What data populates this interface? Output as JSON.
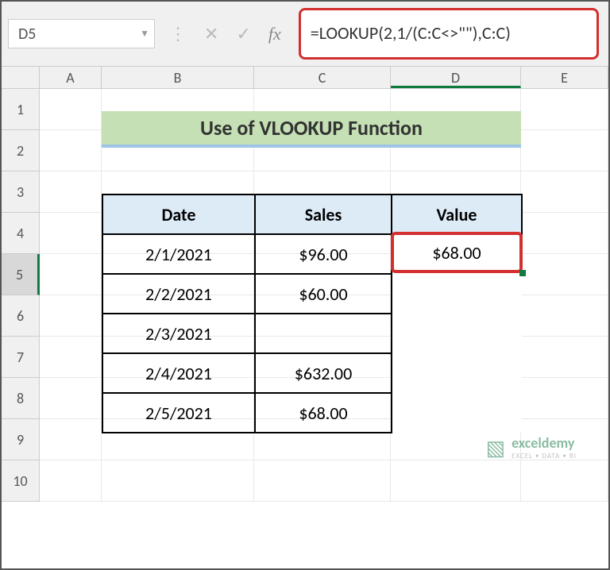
{
  "name_box": "D5",
  "formula": "=LOOKUP(2,1/(C:C<>\"\"),C:C)",
  "columns": [
    "A",
    "B",
    "C",
    "D",
    "E"
  ],
  "row_numbers": [
    "1",
    "2",
    "3",
    "4",
    "5",
    "6",
    "7",
    "8",
    "9",
    "10"
  ],
  "title": "Use of VLOOKUP Function",
  "headers": {
    "date": "Date",
    "sales": "Sales",
    "value": "Value"
  },
  "rows": [
    {
      "date": "2/1/2021",
      "sales": "$96.00"
    },
    {
      "date": "2/2/2021",
      "sales": "$60.00"
    },
    {
      "date": "2/3/2021",
      "sales": ""
    },
    {
      "date": "2/4/2021",
      "sales": "$632.00"
    },
    {
      "date": "2/5/2021",
      "sales": "$68.00"
    }
  ],
  "result_value": "$68.00",
  "selected_cell": "D5",
  "watermark": {
    "brand": "exceldemy",
    "tagline": "EXCEL • DATA • BI"
  }
}
